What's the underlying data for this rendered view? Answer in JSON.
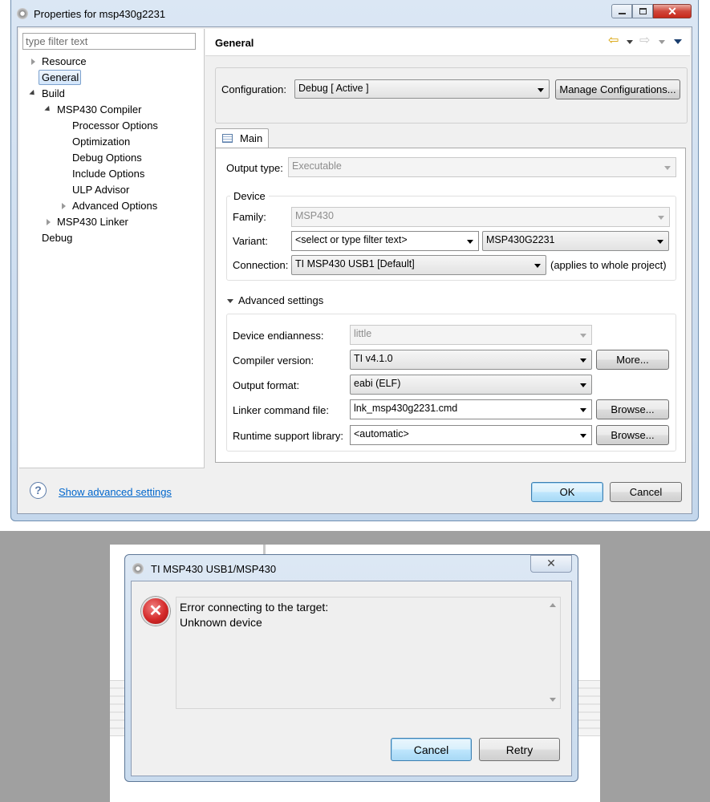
{
  "properties_window": {
    "title": "Properties for msp430g2231",
    "filter_placeholder": "type filter text",
    "tree": {
      "resource": "Resource",
      "general": "General",
      "build": "Build",
      "compiler": "MSP430 Compiler",
      "processor_options": "Processor Options",
      "optimization": "Optimization",
      "debug_options": "Debug Options",
      "include_options": "Include Options",
      "ulp_advisor": "ULP Advisor",
      "advanced_options": "Advanced Options",
      "linker": "MSP430 Linker",
      "debug": "Debug"
    },
    "page_title": "General",
    "configuration_label": "Configuration:",
    "configuration_value": "Debug  [ Active ]",
    "manage_configurations": "Manage Configurations...",
    "tab_main": "Main",
    "output_type_label": "Output type:",
    "output_type_value": "Executable",
    "device_group": "Device",
    "family_label": "Family:",
    "family_value": "MSP430",
    "variant_label": "Variant:",
    "variant_filter": "<select or type filter text>",
    "variant_value": "MSP430G2231",
    "connection_label": "Connection:",
    "connection_value": "TI MSP430 USB1 [Default]",
    "connection_note": "(applies to whole project)",
    "advanced_settings": "Advanced settings",
    "endianness_label": "Device endianness:",
    "endianness_value": "little",
    "compiler_version_label": "Compiler version:",
    "compiler_version_value": "TI v4.1.0",
    "more_button": "More...",
    "output_format_label": "Output format:",
    "output_format_value": "eabi (ELF)",
    "linker_cmd_label": "Linker command file:",
    "linker_cmd_value": "lnk_msp430g2231.cmd",
    "browse_button": "Browse...",
    "runtime_lib_label": "Runtime support library:",
    "runtime_lib_value": "<automatic>",
    "show_advanced": "Show advanced settings",
    "ok": "OK",
    "cancel": "Cancel"
  },
  "error_dialog": {
    "title": "TI MSP430 USB1/MSP430",
    "message_line1": "Error connecting to the target:",
    "message_line2": "Unknown device",
    "cancel": "Cancel",
    "retry": "Retry"
  },
  "colors": {
    "window_frame": "#cbdcef",
    "accent_blue": "#3c7fb1",
    "link": "#0066cc",
    "error_red": "#d42a2a",
    "background_gray": "#a0a0a0"
  }
}
